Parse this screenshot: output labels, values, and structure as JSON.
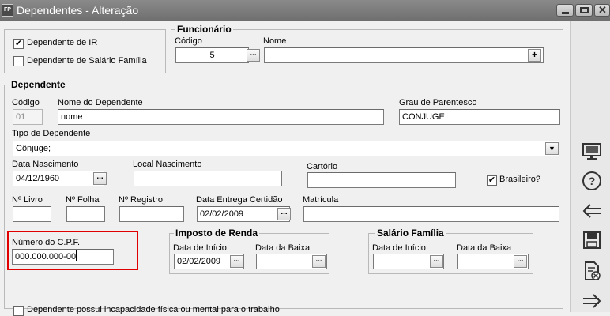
{
  "window": {
    "app_icon": "FP",
    "title": "Dependentes - Alteração"
  },
  "top_checks": {
    "dependente_ir": {
      "label": "Dependente de IR",
      "checked": true
    },
    "dependente_salario_familia": {
      "label": "Dependente de Salário Família",
      "checked": false
    }
  },
  "funcionario": {
    "legend": "Funcionário",
    "codigo_label": "Código",
    "codigo_value": "5",
    "nome_label": "Nome",
    "nome_value": "",
    "lookup_glyph": "...",
    "add_glyph": "+"
  },
  "dependente": {
    "legend": "Dependente",
    "codigo_label": "Código",
    "codigo_value": "01",
    "nome_label": "Nome do Dependente",
    "nome_value": "nome",
    "grau_label": "Grau de Parentesco",
    "grau_value": "CONJUGE",
    "tipo_label": "Tipo de Dependente",
    "tipo_value": "Cônjuge;",
    "data_nasc_label": "Data Nascimento",
    "data_nasc_value": "04/12/1960",
    "local_nasc_label": "Local Nascimento",
    "local_nasc_value": "",
    "cartorio_label": "Cartório",
    "cartorio_value": "",
    "brasileiro_label": "Brasileiro?",
    "brasileiro_checked": true,
    "livro_label": "Nº Livro",
    "livro_value": "",
    "folha_label": "Nº Folha",
    "folha_value": "",
    "registro_label": "Nº Registro",
    "registro_value": "",
    "entrega_label": "Data Entrega Certidão",
    "entrega_value": "02/02/2009",
    "matricula_label": "Matrícula",
    "matricula_value": "",
    "cpf_label": "Número do C.P.F.",
    "cpf_value": "000.000.000-00",
    "incapacidade_label": "Dependente possui incapacidade física ou mental para o trabalho",
    "incapacidade_checked": false
  },
  "imposto_renda": {
    "legend": "Imposto de Renda",
    "inicio_label": "Data de Início",
    "inicio_value": "02/02/2009",
    "baixa_label": "Data da Baixa",
    "baixa_value": ""
  },
  "salario_familia": {
    "legend": "Salário Família",
    "inicio_label": "Data de Início",
    "inicio_value": "",
    "baixa_label": "Data da Baixa",
    "baixa_value": ""
  },
  "glyphs": {
    "check": "✔",
    "dropdown": "▼",
    "dots": "..."
  },
  "side_toolbar": [
    "monitor-icon",
    "help-icon",
    "back-arrow-icon",
    "save-icon",
    "delete-document-icon",
    "forward-arrow-icon"
  ],
  "colors": {
    "titlebar": "#7a7a7a",
    "highlight": "#e00000"
  }
}
